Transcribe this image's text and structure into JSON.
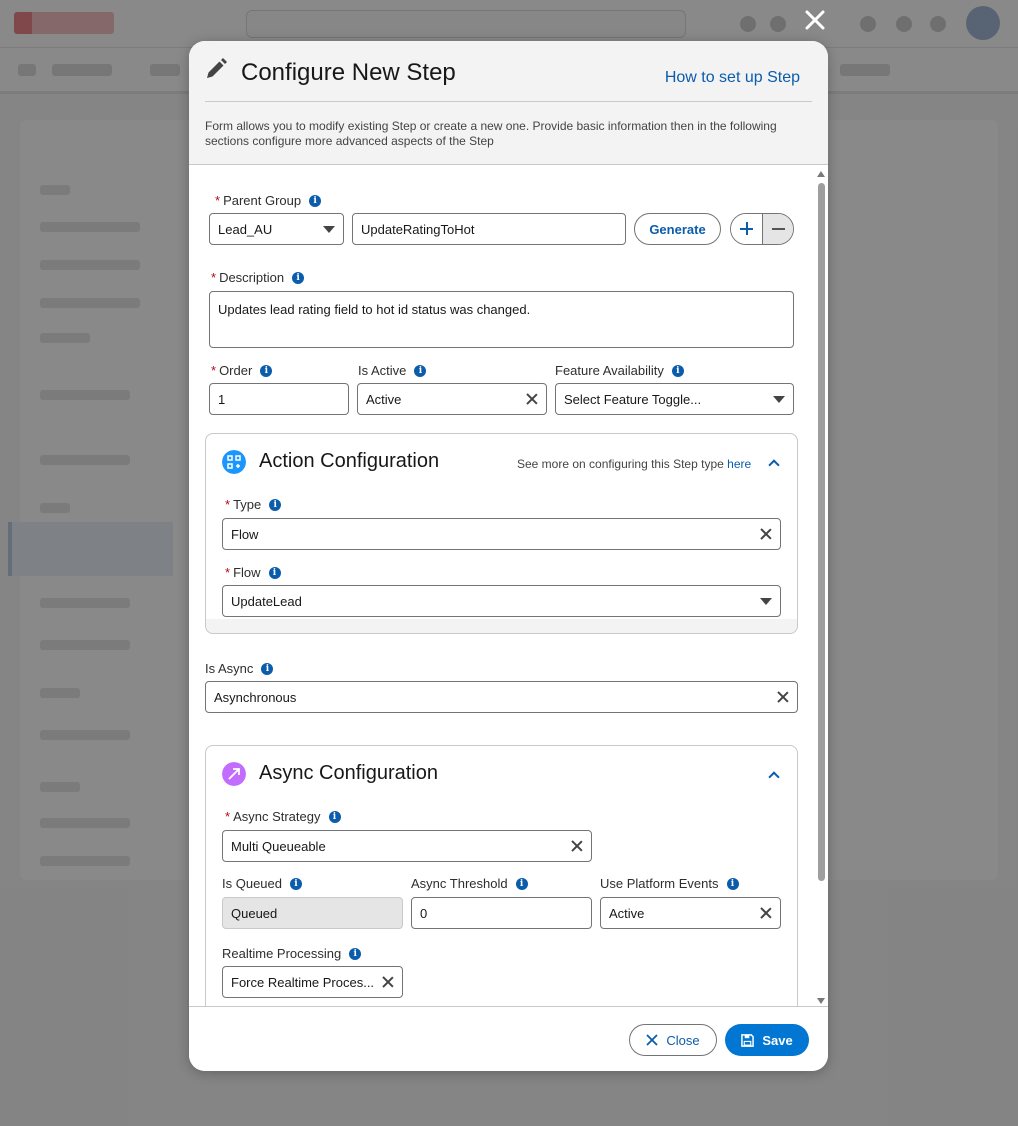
{
  "modal": {
    "title": "Configure New Step",
    "help_link": "How to set up Step",
    "description": "Form allows you to modify existing Step or create a new one. Provide basic information then in the following sections configure more advanced aspects of the Step"
  },
  "form": {
    "parent_group": {
      "label": "Parent Group",
      "value": "Lead_AU",
      "name_value": "UpdateRatingToHot",
      "generate_label": "Generate"
    },
    "description": {
      "label": "Description",
      "value": "Updates lead rating field to hot id status was changed."
    },
    "order": {
      "label": "Order",
      "value": "1"
    },
    "is_active": {
      "label": "Is Active",
      "value": "Active"
    },
    "feature_availability": {
      "label": "Feature Availability",
      "placeholder": "Select Feature Toggle..."
    },
    "is_async": {
      "label": "Is Async",
      "value": "Asynchronous"
    }
  },
  "action_config": {
    "title": "Action Configuration",
    "see_more_text": "See more on configuring this Step type",
    "see_more_link": "here",
    "type": {
      "label": "Type",
      "value": "Flow"
    },
    "flow": {
      "label": "Flow",
      "value": "UpdateLead"
    }
  },
  "async_config": {
    "title": "Async Configuration",
    "async_strategy": {
      "label": "Async Strategy",
      "value": "Multi Queueable"
    },
    "is_queued": {
      "label": "Is Queued",
      "value": "Queued"
    },
    "async_threshold": {
      "label": "Async Threshold",
      "value": "0"
    },
    "use_platform_events": {
      "label": "Use Platform Events",
      "value": "Active"
    },
    "realtime_processing": {
      "label": "Realtime Processing",
      "value": "Force Realtime Proces..."
    }
  },
  "footer": {
    "close_label": "Close",
    "save_label": "Save"
  },
  "colors": {
    "brand": "#0176d3",
    "link": "#0b5cab",
    "required": "#ba0517",
    "action_icon": "#1b96ff",
    "async_icon": "#c36dff"
  }
}
